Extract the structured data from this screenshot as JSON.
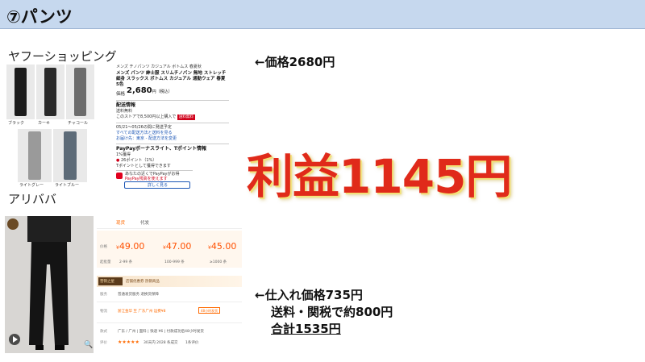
{
  "header": {
    "title": "⑦パンツ"
  },
  "labels": {
    "yahoo": "ヤフーショッピング",
    "alibaba": "アリババ"
  },
  "yahoo_shot": {
    "breadcrumb": "メンズ チノパンツ カジュアル ボトムス 春夏秋",
    "title": "メンズ パンツ 紳士服 スリムチノパン 無地 ストレッチ 細身 スラックス ボトムス カジュアル 通勤ウェア 春夏 5色",
    "price_label": "価格",
    "price": "2,680",
    "price_unit": "円（税込）",
    "shipping_heading": "配送情報",
    "shipping_fee": "送料無料",
    "free_tag": "送料無料",
    "shipping_cond": "このストアで8,500円以上購入で",
    "delivery_date": "05/21〜05/26の間に発送予定",
    "delivery_link": "すべての配送方法と送料を見る",
    "area_link": "お届け先：東京 - 配送方法を変更",
    "paypay_heading": "PayPayボーナスライト、Tポイント情報",
    "point_rate": "1%獲得",
    "point_line": "26ポイント（1%）",
    "point_note": "Tポイントとして獲得できます",
    "paypay_line1": "あなたの近くでPayPayがお得",
    "paypay_line2": "PayPay残高を使えます",
    "paypay_btn": "詳しく見る",
    "swatches": [
      "ブラック",
      "カーキ",
      "チャコール",
      "ライトグレー",
      "ライトブルー"
    ]
  },
  "price_note": "←価格2680円",
  "profit": "利益1145円",
  "cost_note": {
    "line1": "←仕入れ価格735円",
    "line2": "送料・関税で約800円",
    "line3": "合計1535円"
  },
  "alibaba_shot": {
    "tabs": [
      "现货",
      "代发"
    ],
    "price_label": "价格",
    "qty_label": "起批量",
    "currency": "¥",
    "prices": [
      "49.00",
      "47.00",
      "45.00"
    ],
    "qty_ranges": [
      "2-99 条",
      "100-999 条",
      "≥1000 条"
    ],
    "promo_tag": "营销之星",
    "promo_text": "店铺优惠券  热销商品",
    "service_label": "服务",
    "service_text": "普通发货服务  退换货保障",
    "logistics_label": "物流",
    "logistics_text": "浙江金华  至  广东广州  运费¥8",
    "logistics_badge": "48小时发货",
    "style_label": "款式",
    "style_text": "广东 / 广州  |  面料  |  快递 ¥6  |  付款成功后48小时发货",
    "rating_label": "评价",
    "stars": "★★★★★",
    "rating_text": "30天内 2028 条成交",
    "rating_extra": "1条评价"
  }
}
